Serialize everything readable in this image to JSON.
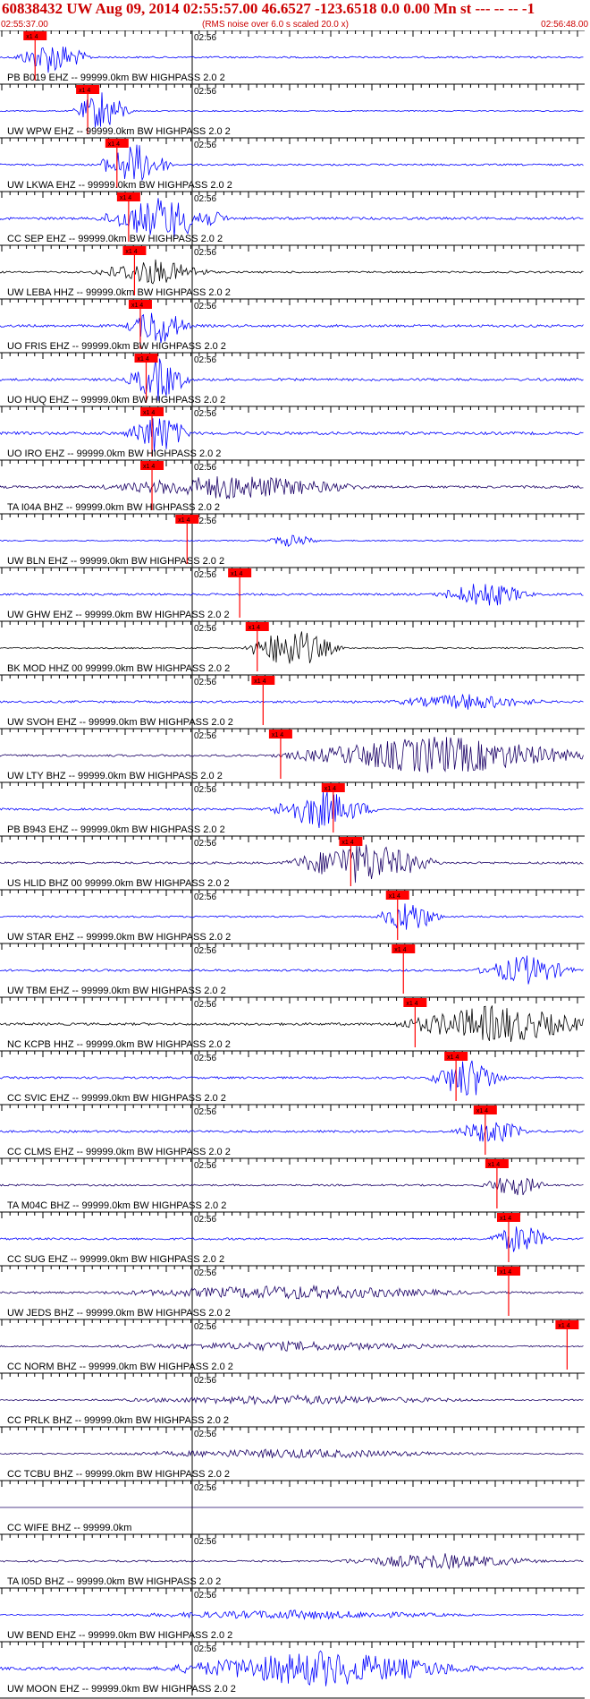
{
  "header": {
    "title": "60838432 UW Aug 09, 2014 02:55:57.00   46.6527 -123.6518  0.0 0.00 Mn st --- -- --   -1",
    "start_time": "02:55:37.00",
    "rms_note": "(RMS noise over 6.0 s scaled 20.0 x)",
    "end_time": "02:56:48.00"
  },
  "minute_label": "02:56",
  "pick_label": "x1 4",
  "colors": {
    "header": "#cc0000",
    "pick": "#ff0000",
    "axis": "#000000"
  },
  "traces": [
    {
      "label": "PB B019 EHZ -- 99999.0km BW  HIGHPASS  2.0  2",
      "color": "#0000ff",
      "pick": 0.06,
      "amp": 0.25,
      "burst": [
        0.09,
        0.03,
        0.8
      ]
    },
    {
      "label": "UW WPW EHZ -- 99999.0km BW  HIGHPASS  2.0  2",
      "color": "#0000ff",
      "pick": 0.15,
      "amp": 0.15,
      "burst": [
        0.175,
        0.015,
        1.0
      ]
    },
    {
      "label": "UW LKWA EHZ -- 99999.0km BW  HIGHPASS  2.0  2",
      "color": "#0000ff",
      "pick": 0.2,
      "amp": 0.25,
      "burst": [
        0.23,
        0.03,
        1.0
      ]
    },
    {
      "label": "CC SEP EHZ -- 99999.0km BW  HIGHPASS  2.0  2",
      "color": "#0000ff",
      "pick": 0.22,
      "amp": 0.35,
      "burst": [
        0.28,
        0.08,
        1.0
      ]
    },
    {
      "label": "UW LEBA HHZ -- 99999.0km BW  HIGHPASS  2.0  2",
      "color": "#000000",
      "pick": 0.23,
      "amp": 0.25,
      "burst": [
        0.26,
        0.07,
        0.6
      ]
    },
    {
      "label": "UO FRIS EHZ -- 99999.0km BW  HIGHPASS  2.0  2",
      "color": "#0000ff",
      "pick": 0.24,
      "amp": 0.35,
      "burst": [
        0.27,
        0.02,
        0.9
      ]
    },
    {
      "label": "UO HUQ EHZ -- 99999.0km BW  HIGHPASS  2.0  2",
      "color": "#0000ff",
      "pick": 0.25,
      "amp": 0.35,
      "burst": [
        0.27,
        0.02,
        1.0
      ]
    },
    {
      "label": "UO IRO EHZ -- 99999.0km BW  HIGHPASS  2.0  2",
      "color": "#0000ff",
      "pick": 0.26,
      "amp": 0.4,
      "burst": [
        0.27,
        0.02,
        1.0
      ]
    },
    {
      "label": "TA I04A BHZ -- 99999.0km BW  HIGHPASS  2.0  2",
      "color": "#1a0066",
      "pick": 0.26,
      "amp": 0.35,
      "burst": [
        0.4,
        0.2,
        0.55
      ]
    },
    {
      "label": "UW BLN EHZ -- 99999.0km BW  HIGHPASS  2.0  2",
      "color": "#0000ff",
      "pick": 0.32,
      "amp": 0.15,
      "burst": [
        0.5,
        0.01,
        0.3
      ]
    },
    {
      "label": "UW GHW EHZ -- 99999.0km BW  HIGHPASS  2.0  2",
      "color": "#0000ff",
      "pick": 0.41,
      "amp": 0.3,
      "burst": [
        0.83,
        0.05,
        0.6
      ]
    },
    {
      "label": "BK MOD HHZ 00 99999.0km BW  HIGHPASS  2.0  2",
      "color": "#000000",
      "pick": 0.44,
      "amp": 0.2,
      "burst": [
        0.5,
        0.05,
        1.0
      ]
    },
    {
      "label": "UW SVOH EHZ -- 99999.0km BW  HIGHPASS  2.0  2",
      "color": "#0000ff",
      "pick": 0.45,
      "amp": 0.3,
      "burst": [
        0.8,
        0.1,
        0.35
      ]
    },
    {
      "label": "UW LTY BHZ -- 99999.0km BW  HIGHPASS  2.0  2",
      "color": "#1a0066",
      "pick": 0.48,
      "amp": 0.3,
      "burst": [
        0.75,
        0.25,
        0.9
      ]
    },
    {
      "label": "PB B943 EHZ -- 99999.0km BW  HIGHPASS  2.0  2",
      "color": "#0000ff",
      "pick": 0.57,
      "amp": 0.3,
      "burst": [
        0.55,
        0.06,
        0.9
      ]
    },
    {
      "label": "US HLID BHZ 00 99999.0km BW  HIGHPASS  2.0  2",
      "color": "#1a0066",
      "pick": 0.6,
      "amp": 0.3,
      "burst": [
        0.62,
        0.1,
        1.0
      ]
    },
    {
      "label": "UW STAR EHZ -- 99999.0km BW  HIGHPASS  2.0  2",
      "color": "#0000ff",
      "pick": 0.68,
      "amp": 0.25,
      "burst": [
        0.7,
        0.02,
        0.8
      ]
    },
    {
      "label": "UW TBM EHZ -- 99999.0km BW  HIGHPASS  2.0  2",
      "color": "#0000ff",
      "pick": 0.69,
      "amp": 0.3,
      "burst": [
        0.9,
        0.05,
        0.7
      ]
    },
    {
      "label": "NC KCPB HHZ -- 99999.0km BW  HIGHPASS  2.0  2",
      "color": "#000000",
      "pick": 0.71,
      "amp": 0.35,
      "burst": [
        0.85,
        0.15,
        0.9
      ]
    },
    {
      "label": "CC SVIC EHZ -- 99999.0km BW  HIGHPASS  2.0  2",
      "color": "#0000ff",
      "pick": 0.78,
      "amp": 0.3,
      "burst": [
        0.8,
        0.03,
        1.0
      ]
    },
    {
      "label": "CC CLMS EHZ -- 99999.0km BW  HIGHPASS  2.0  2",
      "color": "#0000ff",
      "pick": 0.83,
      "amp": 0.3,
      "burst": [
        0.84,
        0.03,
        0.6
      ]
    },
    {
      "label": "TA M04C BHZ -- 99999.0km BW  HIGHPASS  2.0  2",
      "color": "#1a0066",
      "pick": 0.85,
      "amp": 0.25,
      "burst": [
        0.88,
        0.02,
        0.55
      ]
    },
    {
      "label": "CC SUG EHZ -- 99999.0km BW  HIGHPASS  2.0  2",
      "color": "#0000ff",
      "pick": 0.87,
      "amp": 0.3,
      "burst": [
        0.89,
        0.02,
        0.7
      ]
    },
    {
      "label": "UW JEDS BHZ -- 99999.0km BW  HIGHPASS  2.0  2",
      "color": "#1a0066",
      "pick": 0.87,
      "amp": 0.3,
      "burst": [
        0.5,
        0.3,
        0.3
      ]
    },
    {
      "label": "CC NORM BHZ -- 99999.0km BW  HIGHPASS  2.0  2",
      "color": "#1a0066",
      "pick": 0.97,
      "amp": 0.2,
      "burst": [
        0.5,
        0.3,
        0.2
      ]
    },
    {
      "label": "CC PRLK BHZ -- 99999.0km BW  HIGHPASS  2.0  2",
      "color": "#1a0066",
      "pick": null,
      "amp": 0.2,
      "burst": [
        0.5,
        0.3,
        0.2
      ]
    },
    {
      "label": "CC TCBU BHZ -- 99999.0km BW  HIGHPASS  2.0  2",
      "color": "#1a0066",
      "pick": null,
      "amp": 0.2,
      "burst": [
        0.5,
        0.3,
        0.2
      ]
    },
    {
      "label": "CC WIFE BHZ -- 99999.0km",
      "color": "#1a0066",
      "pick": null,
      "amp": 0.0,
      "burst": [
        0.5,
        0.3,
        0.0
      ]
    },
    {
      "label": "TA I05D BHZ -- 99999.0km BW  HIGHPASS  2.0  2",
      "color": "#1a0066",
      "pick": null,
      "amp": 0.25,
      "burst": [
        0.75,
        0.15,
        0.35
      ]
    },
    {
      "label": "UW BEND EHZ -- 99999.0km BW  HIGHPASS  2.0  2",
      "color": "#0000ff",
      "pick": null,
      "amp": 0.15,
      "burst": [
        0.5,
        0.3,
        0.2
      ]
    },
    {
      "label": "UW MOON EHZ -- 99999.0km BW  HIGHPASS  2.0  2",
      "color": "#0000ff",
      "pick": null,
      "amp": 0.4,
      "burst": [
        0.55,
        0.25,
        0.8
      ]
    }
  ]
}
